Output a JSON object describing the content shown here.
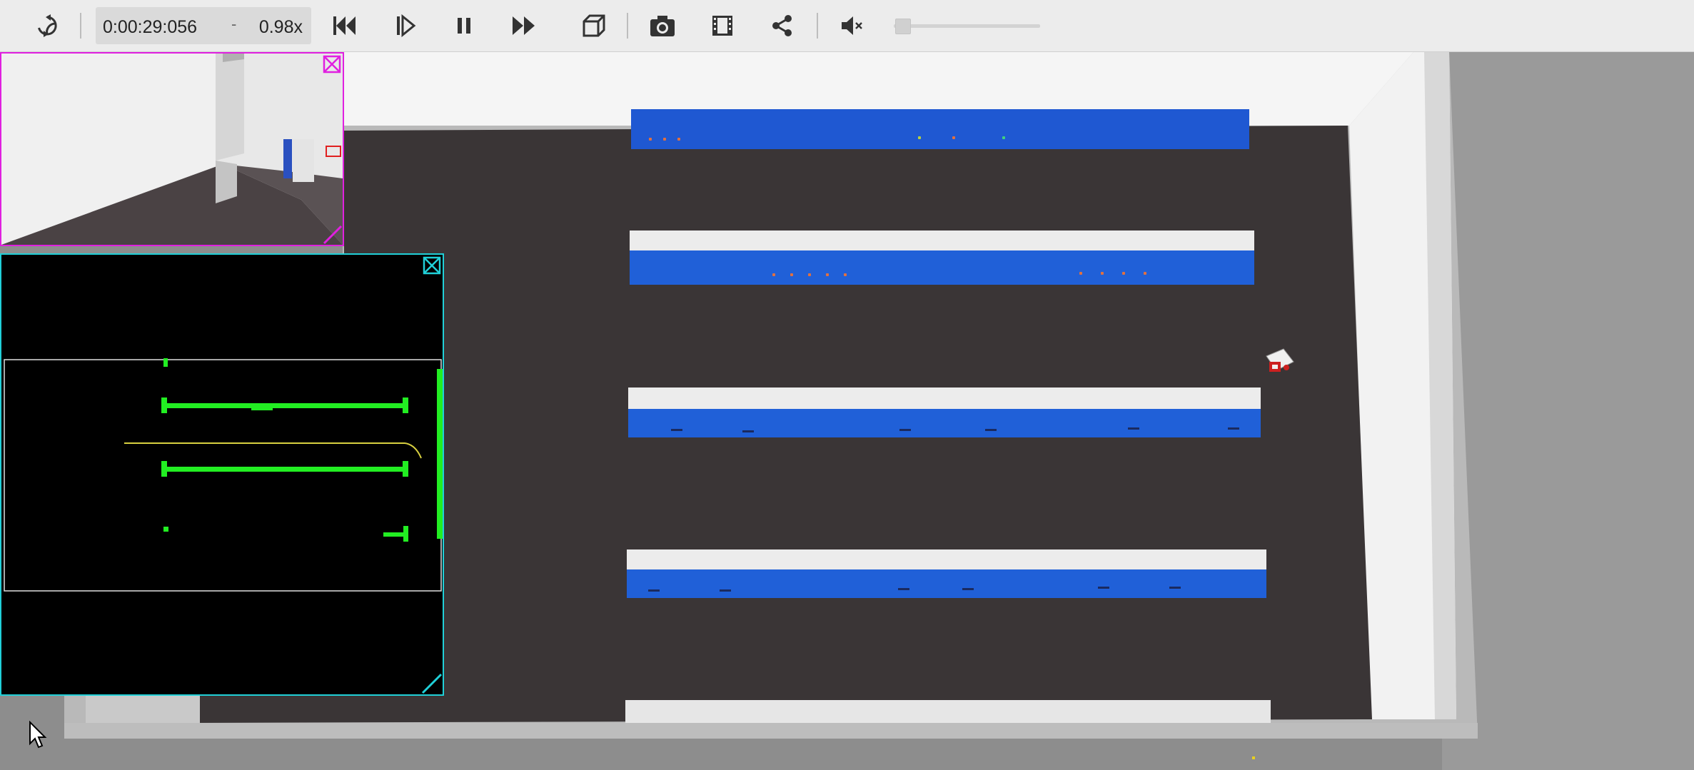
{
  "toolbar": {
    "time": "0:00:29:056",
    "time_separator": "-",
    "speed": "0.98x",
    "icons": {
      "reload": "reload-icon",
      "reset": "skip-to-start-icon",
      "step": "step-forward-icon",
      "pause": "pause-icon",
      "fast_forward": "fast-forward-icon",
      "view": "3d-view-icon",
      "screenshot": "camera-icon",
      "record": "film-icon",
      "share": "share-icon",
      "mute": "mute-icon"
    },
    "volume_level": 0.0
  },
  "overlays": {
    "camera": {
      "border_color": "#e020e0",
      "icon": "close-icon"
    },
    "lidar": {
      "border_color": "#20d0d8",
      "icon": "close-icon"
    }
  },
  "colors": {
    "shelf_blue": "#2060d8",
    "floor": "#3a3536",
    "lidar_points": "#22ee22",
    "lidar_path": "#d8d040"
  }
}
